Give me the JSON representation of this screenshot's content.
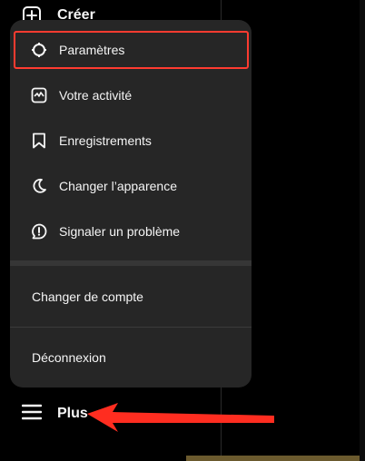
{
  "top": {
    "create_label": "Créer"
  },
  "menu": {
    "items": [
      {
        "label": "Paramètres",
        "icon": "gear-icon"
      },
      {
        "label": "Votre activité",
        "icon": "activity-icon"
      },
      {
        "label": "Enregistrements",
        "icon": "bookmark-icon"
      },
      {
        "label": "Changer l’apparence",
        "icon": "moon-icon"
      },
      {
        "label": "Signaler un problème",
        "icon": "report-icon"
      }
    ],
    "switch_account": "Changer de compte",
    "logout": "Déconnexion"
  },
  "bottom": {
    "more_label": "Plus"
  },
  "colors": {
    "highlight": "#ff3b30",
    "menu_bg": "#262626",
    "arrow": "#ff2d20"
  }
}
